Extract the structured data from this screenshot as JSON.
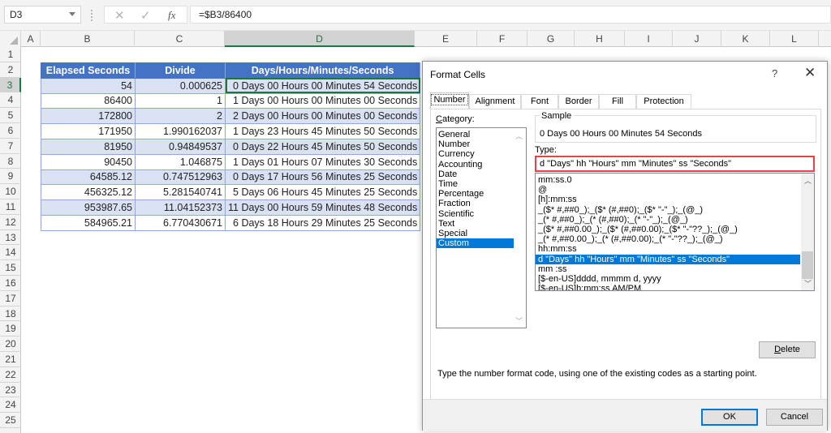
{
  "formula_bar": {
    "name_box": "D3",
    "cancel_icon": "✕",
    "enter_icon": "✓",
    "fx_label": "fx",
    "formula": "=$B3/86400"
  },
  "columns": [
    "A",
    "B",
    "C",
    "D",
    "E",
    "F",
    "G",
    "H",
    "I",
    "J",
    "K",
    "L"
  ],
  "selected_column": "D",
  "rows": [
    "1",
    "2",
    "3",
    "4",
    "5",
    "6",
    "7",
    "8",
    "9",
    "10",
    "11",
    "12",
    "13",
    "14",
    "15",
    "16",
    "17",
    "18",
    "19",
    "20",
    "21",
    "22",
    "23",
    "24",
    "25"
  ],
  "selected_row": "3",
  "table": {
    "headers": [
      "Elapsed Seconds",
      "Divide",
      "Days/Hours/Minutes/Seconds"
    ],
    "rows": [
      [
        "54",
        "0.000625",
        "0 Days 00 Hours 00 Minutes 54 Seconds"
      ],
      [
        "86400",
        "1",
        "1 Days 00 Hours 00 Minutes 00 Seconds"
      ],
      [
        "172800",
        "2",
        "2 Days 00 Hours 00 Minutes 00 Seconds"
      ],
      [
        "171950",
        "1.990162037",
        "1 Days 23 Hours 45 Minutes 50 Seconds"
      ],
      [
        "81950",
        "0.94849537",
        "0 Days 22 Hours 45 Minutes 50 Seconds"
      ],
      [
        "90450",
        "1.046875",
        "1 Days 01 Hours 07 Minutes 30 Seconds"
      ],
      [
        "64585.12",
        "0.747512963",
        "0 Days 17 Hours 56 Minutes 25 Seconds"
      ],
      [
        "456325.12",
        "5.281540741",
        "5 Days 06 Hours 45 Minutes 25 Seconds"
      ],
      [
        "953987.65",
        "11.04152373",
        "11 Days 00 Hours 59 Minutes 48 Seconds"
      ],
      [
        "584965.21",
        "6.770430671",
        "6 Days 18 Hours 29 Minutes 25 Seconds"
      ]
    ]
  },
  "dialog": {
    "title": "Format Cells",
    "help": "?",
    "close": "✕",
    "tabs": [
      "Number",
      "Alignment",
      "Font",
      "Border",
      "Fill",
      "Protection"
    ],
    "active_tab": "Number",
    "category_label": "Category:",
    "categories": [
      "General",
      "Number",
      "Currency",
      "Accounting",
      "Date",
      "Time",
      "Percentage",
      "Fraction",
      "Scientific",
      "Text",
      "Special",
      "Custom"
    ],
    "selected_category": "Custom",
    "sample_label": "Sample",
    "sample_value": "0 Days 00 Hours 00 Minutes 54 Seconds",
    "type_label": "Type:",
    "type_value": "d \"Days\" hh \"Hours\" mm \"Minutes\" ss \"Seconds\"",
    "format_codes": [
      "mm:ss.0",
      "@",
      "[h]:mm:ss",
      "_($* #,##0_);_($* (#,##0);_($* \"-\"_);_(@_)",
      "_(* #,##0_);_(* (#,##0);_(* \"-\"_);_(@_)",
      "_($* #,##0.00_);_($* (#,##0.00);_($* \"-\"??_);_(@_)",
      "_(* #,##0.00_);_(* (#,##0.00);_(* \"-\"??_);_(@_)",
      "hh:mm:ss",
      "d \"Days\" hh \"Hours\" mm \"Minutes\" ss \"Seconds\"",
      "mm :ss",
      "[$-en-US]dddd, mmmm d, yyyy",
      "[$-en-US]h:mm:ss AM/PM"
    ],
    "selected_format_index": 8,
    "delete_button": "Delete",
    "hint": "Type the number format code, using one of the existing codes as a starting point.",
    "ok_button": "OK",
    "cancel_button": "Cancel"
  }
}
